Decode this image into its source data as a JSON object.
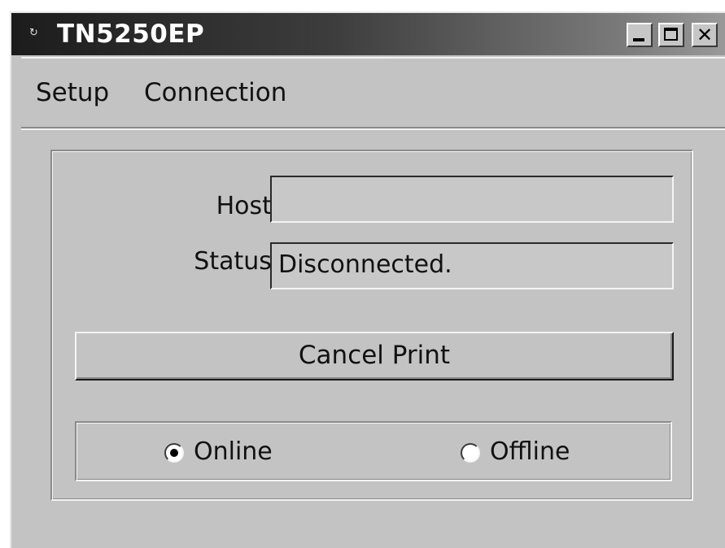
{
  "window": {
    "title": "TN5250EP",
    "system_icon": "system-menu-icon"
  },
  "titlebar_buttons": {
    "minimize_icon": "minimize-icon",
    "maximize_icon": "maximize-icon",
    "close_icon": "close-icon",
    "close_glyph": "✕"
  },
  "menu": {
    "items": [
      {
        "label": "Setup"
      },
      {
        "label": "Connection"
      }
    ]
  },
  "form": {
    "host_label": "Host:",
    "host_value": "",
    "status_label": "Status:",
    "status_value": "Disconnected."
  },
  "actions": {
    "cancel_print_label": "Cancel Print"
  },
  "mode": {
    "options": [
      {
        "label": "Online",
        "selected": true
      },
      {
        "label": "Offline",
        "selected": false
      }
    ]
  },
  "colors": {
    "window_bg": "#c3c3c3",
    "titlebar_dark": "#1c1c1c",
    "titlebar_light": "#9a9a9a"
  }
}
